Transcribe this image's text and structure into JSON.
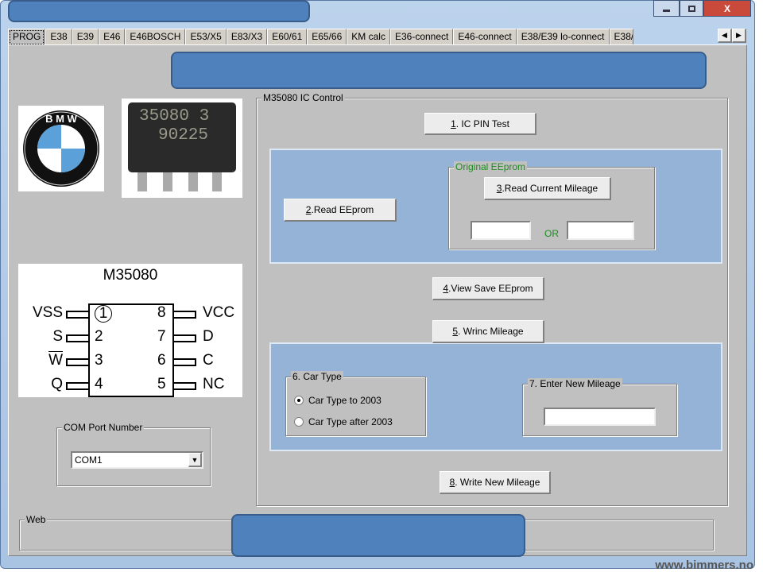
{
  "window": {
    "minimize_icon": "minimize-icon",
    "maximize_icon": "maximize-icon",
    "close_label": "X"
  },
  "tabs": [
    "PROG",
    "E38",
    "E39",
    "E46",
    "E46BOSCH",
    "E53/X5",
    "E83/X3",
    "E60/61",
    "E65/66",
    "KM calc",
    "E36-connect",
    "E46-connect",
    "E38/E39 lo-connect",
    "E38/"
  ],
  "left": {
    "chip_photo_text": [
      "35080 3",
      "90225"
    ],
    "logo_text": "BMW",
    "diagram": {
      "title": "M35080",
      "left_pins": [
        {
          "name": "VSS",
          "num": "1"
        },
        {
          "name": "S",
          "num": "2"
        },
        {
          "name": "W",
          "num": "3"
        },
        {
          "name": "Q",
          "num": "4"
        }
      ],
      "right_pins": [
        {
          "name": "VCC",
          "num": "8"
        },
        {
          "name": "D",
          "num": "7"
        },
        {
          "name": "C",
          "num": "6"
        },
        {
          "name": "NC",
          "num": "5"
        }
      ]
    },
    "com_port": {
      "label": "COM Port Number",
      "value": "COM1"
    }
  },
  "control": {
    "title": "M35080 IC Control",
    "btn1": {
      "key": "1",
      "rest": ". IC PIN Test"
    },
    "btn2": {
      "key": "2",
      "rest": ".Read EEprom"
    },
    "original": {
      "title": "Original EEprom",
      "or_label": "OR",
      "value1": "",
      "value2": ""
    },
    "btn3": {
      "key": "3",
      "rest": ".Read Current Mileage"
    },
    "btn4": {
      "key": "4",
      "rest": ".View Save EEprom"
    },
    "btn5": {
      "key": "5",
      "rest": ". Wrinc Mileage"
    },
    "car_type": {
      "title": "6. Car Type",
      "options": [
        "Car Type to 2003",
        "Car Type after 2003"
      ],
      "selected": 0
    },
    "new_mileage": {
      "title": "7. Enter New Mileage",
      "value": ""
    },
    "btn8": {
      "key": "8",
      "rest": ". Write New Mileage"
    }
  },
  "web": {
    "label": "Web"
  },
  "watermark": "www.bimmers.no",
  "colors": {
    "redaction": "#4f81bd",
    "panel": "#95b3d7",
    "body": "#c0c0c0",
    "green_text": "#1e8c1e"
  }
}
